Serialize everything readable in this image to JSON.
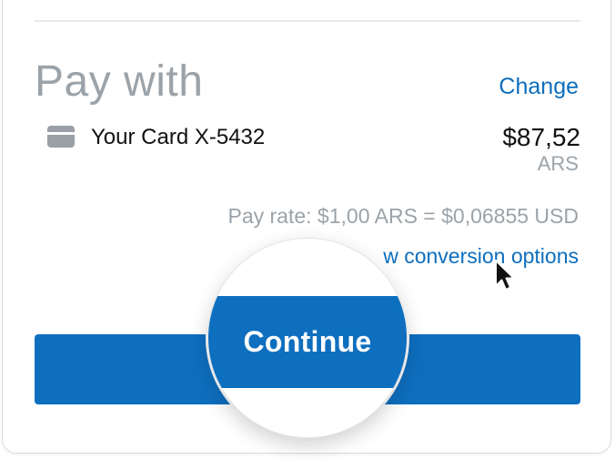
{
  "payment": {
    "heading": "Pay with",
    "change_label": "Change",
    "card": {
      "icon": "credit-card-icon",
      "name": "Your Card X-5432",
      "amount": "$87,52",
      "currency": "ARS"
    },
    "pay_rate": "Pay rate: $1,00 ARS = $0,06855 USD",
    "conversion_link_visible": "w conversion options",
    "continue_label": "Continue"
  },
  "colors": {
    "accent": "#0e6fbf",
    "link": "#0d6ebd",
    "muted": "#9ba3a9",
    "text": "#111111"
  },
  "icons": {
    "cursor": "mouse-pointer-icon"
  }
}
